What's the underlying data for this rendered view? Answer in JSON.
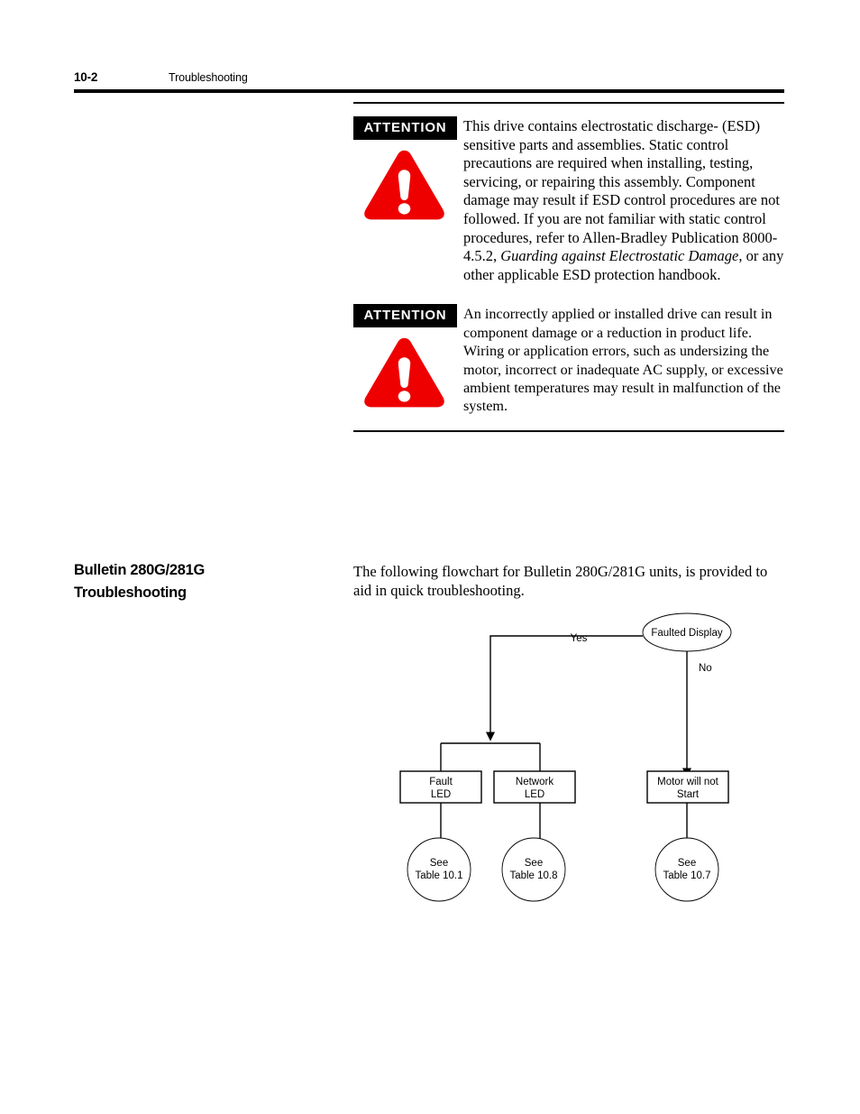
{
  "header": {
    "folio": "10-2",
    "title": "Troubleshooting"
  },
  "attention": {
    "tag_label": "ATTENTION",
    "notices": [
      {
        "text_before_italic": "This drive contains electrostatic discharge- (ESD) sensitive parts and assemblies. Static control precautions are required when installing, testing, servicing, or repairing this assembly. Component damage may result if ESD control procedures are not followed. If you are not familiar with static control procedures, refer to Allen-Bradley Publication 8000-4.5.2, ",
        "italic_text": "Guarding against Electrostatic Damage",
        "text_after_italic": ", or any other applicable ESD protection handbook."
      },
      {
        "text": "An incorrectly applied or installed drive can result in component damage or a reduction in product life. Wiring or application errors, such as undersizing the motor, incorrect or inadequate AC supply, or excessive ambient temperatures may result in malfunction of the system."
      }
    ],
    "icon_color": "#ee0000"
  },
  "section": {
    "heading_line1": "Bulletin 280G/281G",
    "heading_line2": "Troubleshooting",
    "intro": "The following flowchart for Bulletin 280G/281G units, is provided to aid in quick troubleshooting."
  },
  "flowchart": {
    "start_node": "Faulted Display",
    "branch_yes": "Yes",
    "branch_no": "No",
    "boxes": [
      {
        "line1": "Fault",
        "line2": "LED"
      },
      {
        "line1": "Network",
        "line2": "LED"
      },
      {
        "line1": "Motor will not",
        "line2": "Start"
      }
    ],
    "circles": [
      {
        "line1": "See",
        "line2": "Table 10.1"
      },
      {
        "line1": "See",
        "line2": "Table 10.8"
      },
      {
        "line1": "See",
        "line2": "Table 10.7"
      }
    ]
  }
}
